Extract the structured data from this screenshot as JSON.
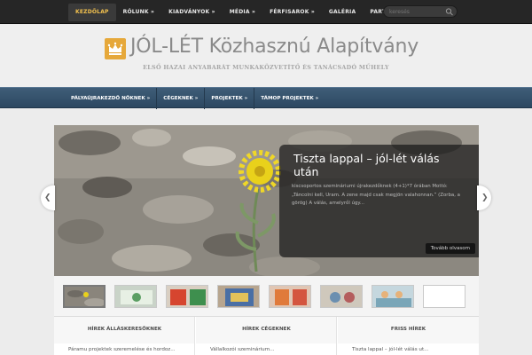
{
  "topnav": {
    "items": [
      {
        "label": "KEZDŐLAP",
        "active": true
      },
      {
        "label": "RÓLUNK »"
      },
      {
        "label": "KIADVÁNYOK »"
      },
      {
        "label": "MÉDIA »"
      },
      {
        "label": "FÉRFISAROK »"
      },
      {
        "label": "GALÉRIA"
      },
      {
        "label": "PARTNEREINK"
      }
    ],
    "search_placeholder": "keresés"
  },
  "header": {
    "title": "JÓL-LÉT Közhasznú Alapítvány",
    "tagline": "ELSŐ HAZAI ANYABARÁT MUNKAKÖZVETÍTŐ ÉS TANÁCSADÓ MŰHELY"
  },
  "catnav": {
    "items": [
      {
        "label": "PÁLYAÚJRAKEZDŐ NŐKNEK »"
      },
      {
        "label": "CÉGEKNEK »"
      },
      {
        "label": "PROJEKTEK »"
      },
      {
        "label": "TÁMOP PROJEKTEK »"
      }
    ]
  },
  "slider": {
    "title": "Tiszta lappal – jól-lét válás után",
    "excerpt": "kiscsoportos szemináriumi újrakezdőknek (4+1)*7 órában Mottó: „Táncolni kell, Uram. A zene majd csak megjön valahonnan.” (Zorba, a görög) A válás, amelyről úgy...",
    "more_label": "Tovább olvasom",
    "prev_glyph": "❮",
    "next_glyph": "❯"
  },
  "thumbs": {
    "count": 8,
    "active_index": 0,
    "colors": [
      "#8a857c",
      "#c9d3c8",
      "#d9cfc2",
      "#b7a58f",
      "#e0c6b4",
      "#cfc8bc",
      "#c5d7de",
      "#ffffff"
    ]
  },
  "columns": [
    {
      "heading": "HÍREK ÁLLÁSKERESŐKNEK",
      "preview": "Páramu projektek szeremelése és hordoz..."
    },
    {
      "heading": "HÍREK CÉGEKNEK",
      "preview": "Vállalkozói szeminárium..."
    },
    {
      "heading": "FRISS HÍREK",
      "preview": "Tiszta lappal – jól-lét válás ut..."
    }
  ],
  "colors": {
    "topbar": "#262626",
    "accent": "#f2c14e",
    "catbar": "#34536e",
    "logo": "#e6a83a"
  }
}
